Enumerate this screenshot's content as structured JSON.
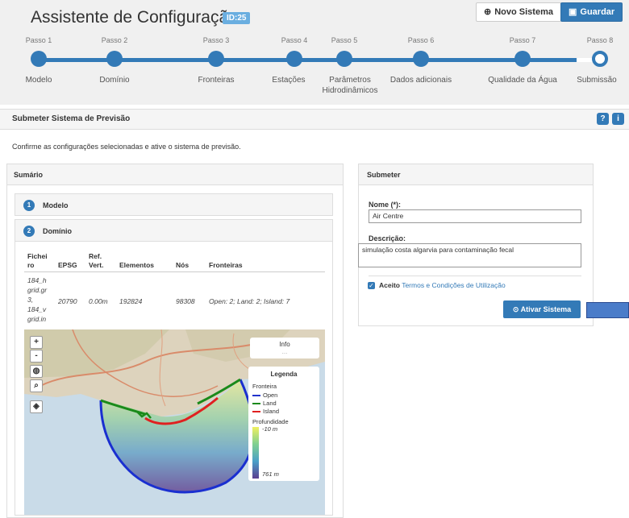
{
  "header": {
    "title": "Assistente de Configuração",
    "id_badge": "ID:25",
    "new_system_label": "Novo Sistema",
    "save_label": "Guardar"
  },
  "steps": [
    {
      "step": "Passo 1",
      "name": "Modelo"
    },
    {
      "step": "Passo 2",
      "name": "Domínio"
    },
    {
      "step": "Passo 3",
      "name": "Fronteiras"
    },
    {
      "step": "Passo 4",
      "name": "Estações"
    },
    {
      "step": "Passo 5",
      "name": "Parâmetros Hidrodinâmicos"
    },
    {
      "step": "Passo 6",
      "name": "Dados adicionais"
    },
    {
      "step": "Passo 7",
      "name": "Qualidade da Água"
    },
    {
      "step": "Passo 8",
      "name": "Submissão"
    }
  ],
  "section": {
    "title": "Submeter Sistema de Previsão",
    "help1": "?",
    "help2": "i",
    "intro": "Confirme as configurações selecionadas e ative o sistema de previsão."
  },
  "summary": {
    "title": "Sumário",
    "accordions": [
      {
        "num": "1",
        "label": "Modelo"
      },
      {
        "num": "2",
        "label": "Domínio"
      }
    ],
    "table": {
      "headers": [
        "Fichei ro",
        "EPSG",
        "Ref. Vert.",
        "Elementos",
        "Nós",
        "Fronteiras"
      ],
      "row": [
        "184_h grid.gr 3, 184_v grid.in",
        "20790",
        "0.00m",
        "192824",
        "98308",
        "Open: 2; Land: 2; Island: 7"
      ]
    },
    "map": {
      "info_title": "Info",
      "info_sub": "...",
      "legend_title": "Legenda",
      "legend_group1": "Fronteira",
      "legend_items": [
        {
          "label": "Open",
          "color": "#2233cc"
        },
        {
          "label": "Land",
          "color": "#1a8a1a"
        },
        {
          "label": "Island",
          "color": "#e02020"
        }
      ],
      "legend_group2": "Profundidade",
      "depth_min": "-10 m",
      "depth_max": "761 m",
      "zoom_in": "+",
      "zoom_out": "-"
    }
  },
  "submit": {
    "title": "Submeter",
    "name_label": "Nome (*):",
    "name_value": "Air Centre",
    "desc_label": "Descrição:",
    "desc_value": "simulação costa algarvia para contaminação fecal",
    "accept_label": "Aceito",
    "terms_link": "Termos e Condições de Utilização",
    "activate_label": "Ativar Sistema"
  },
  "colors": {
    "primary": "#337ab7",
    "badge": "#6aaee0"
  }
}
